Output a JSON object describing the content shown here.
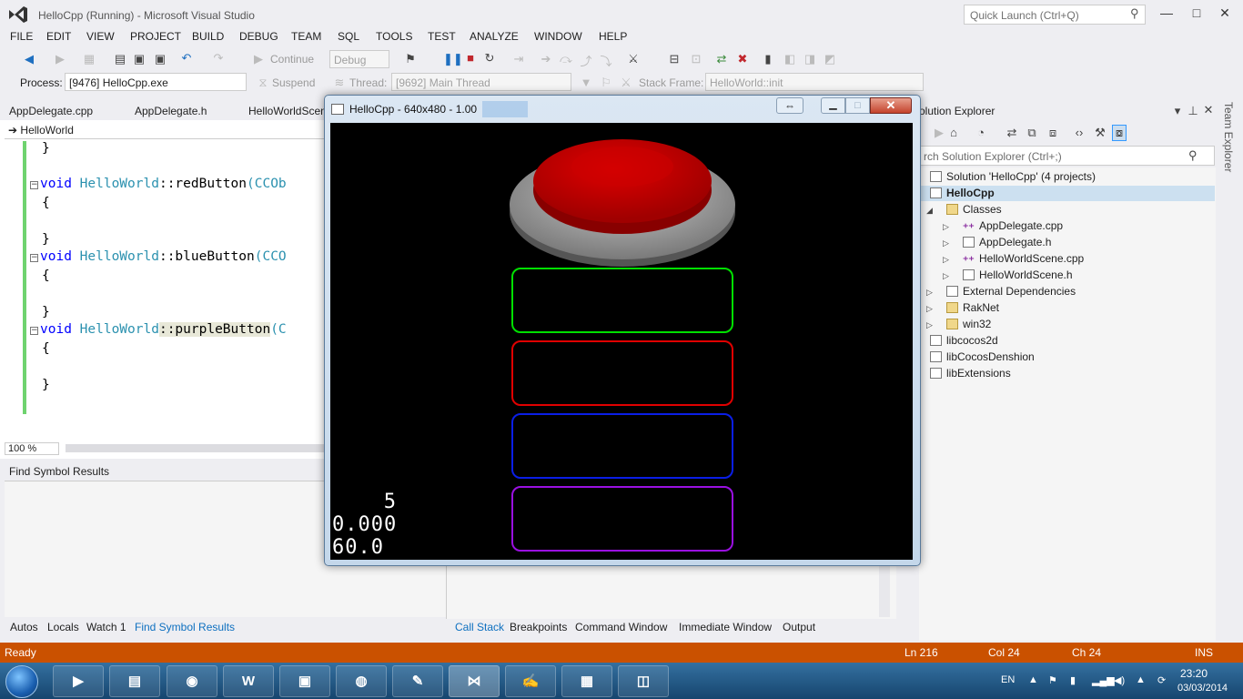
{
  "window": {
    "title": "HelloCpp (Running) - Microsoft Visual Studio",
    "quick_launch_placeholder": "Quick Launch (Ctrl+Q)",
    "minimize_glyph": "—",
    "maximize_glyph": "□",
    "close_glyph": "✕"
  },
  "menu": [
    "FILE",
    "EDIT",
    "VIEW",
    "PROJECT",
    "BUILD",
    "DEBUG",
    "TEAM",
    "SQL",
    "TOOLS",
    "TEST",
    "ANALYZE",
    "WINDOW",
    "HELP"
  ],
  "toolbar": {
    "continue_label": "Continue",
    "config_value": "Debug",
    "process_label": "Process:",
    "process_value": "[9476] HelloCpp.exe",
    "suspend_label": "Suspend",
    "thread_label": "Thread:",
    "thread_value": "[9692] Main Thread",
    "stack_frame_label": "Stack Frame:",
    "stack_frame_value": "HelloWorld::init"
  },
  "editor": {
    "tabs": [
      "AppDelegate.cpp",
      "AppDelegate.h",
      "HelloWorldScen"
    ],
    "nav_value": "HelloWorld",
    "nav_arrow": "➔",
    "zoom_value": "100 %",
    "lines": [
      {
        "kw": "",
        "cls": "",
        "fn": "}",
        "sig": ""
      },
      {
        "kw": "void",
        "cls": "HelloWorld",
        "fn": "::redButton",
        "sig": "(CCOb"
      },
      {
        "kw": "",
        "cls": "",
        "fn": "{",
        "sig": ""
      },
      {
        "kw": "",
        "cls": "",
        "fn": "}",
        "sig": ""
      },
      {
        "kw": "void",
        "cls": "HelloWorld",
        "fn": "::blueButton",
        "sig": "(CCO"
      },
      {
        "kw": "",
        "cls": "",
        "fn": "{",
        "sig": ""
      },
      {
        "kw": "",
        "cls": "",
        "fn": "}",
        "sig": ""
      },
      {
        "kw": "void",
        "cls": "HelloWorld",
        "fn": "::purpleButton",
        "sig": "(C"
      },
      {
        "kw": "",
        "cls": "",
        "fn": "{",
        "sig": ""
      },
      {
        "kw": "",
        "cls": "",
        "fn": "}",
        "sig": ""
      }
    ]
  },
  "find_symbol": {
    "title": "Find Symbol Results"
  },
  "bottom_tabs_left": [
    "Autos",
    "Locals",
    "Watch 1",
    "Find Symbol Results"
  ],
  "bottom_tabs_right": [
    "Call Stack",
    "Breakpoints",
    "Command Window",
    "Immediate Window",
    "Output"
  ],
  "solution_explorer": {
    "title": "olution Explorer",
    "search_placeholder": "rch Solution Explorer (Ctrl+;)",
    "tree": [
      {
        "label": "Solution 'HelloCpp' (4 projects)",
        "level": 0,
        "arrow": "",
        "bold": false
      },
      {
        "label": "HelloCpp",
        "level": 0,
        "arrow": "",
        "bold": true
      },
      {
        "label": "Classes",
        "level": 1,
        "arrow": "◢",
        "bold": false
      },
      {
        "label": "AppDelegate.cpp",
        "level": 2,
        "arrow": "▷",
        "bold": false
      },
      {
        "label": "AppDelegate.h",
        "level": 2,
        "arrow": "▷",
        "bold": false
      },
      {
        "label": "HelloWorldScene.cpp",
        "level": 2,
        "arrow": "▷",
        "bold": false
      },
      {
        "label": "HelloWorldScene.h",
        "level": 2,
        "arrow": "▷",
        "bold": false
      },
      {
        "label": "External Dependencies",
        "level": 1,
        "arrow": "▷",
        "bold": false
      },
      {
        "label": "RakNet",
        "level": 1,
        "arrow": "▷",
        "bold": false
      },
      {
        "label": "win32",
        "level": 1,
        "arrow": "▷",
        "bold": false
      },
      {
        "label": "libcocos2d",
        "level": 0,
        "arrow": "",
        "bold": false
      },
      {
        "label": "libCocosDenshion",
        "level": 0,
        "arrow": "",
        "bold": false
      },
      {
        "label": "libExtensions",
        "level": 0,
        "arrow": "",
        "bold": false
      }
    ],
    "side_tab": "Team Explorer"
  },
  "status": {
    "ready": "Ready",
    "ln": "Ln 216",
    "col": "Col 24",
    "ch": "Ch 24",
    "ins": "INS"
  },
  "game_window": {
    "title": "HelloCpp - 640x480 - 1.00",
    "stats": [
      "5",
      "0.000",
      "60.0"
    ],
    "buttons": [
      {
        "name": "green",
        "color": "#00e000"
      },
      {
        "name": "red",
        "color": "#e00000"
      },
      {
        "name": "blue",
        "color": "#0a1ee6"
      },
      {
        "name": "purple",
        "color": "#9a10e0"
      }
    ],
    "big_button_color": "#dd0000"
  },
  "taskbar": {
    "apps": [
      "media-player",
      "file-explorer",
      "chrome",
      "word",
      "remote-desktop",
      "owl-app",
      "paint",
      "visual-studio",
      "notepad",
      "calculator",
      "window-app"
    ],
    "lang": "EN",
    "time": "23:20",
    "date": "03/03/2014"
  },
  "colors": {
    "accent": "#ca5100",
    "link": "#0e70c0",
    "editor_gutter": "#6fd36f"
  }
}
